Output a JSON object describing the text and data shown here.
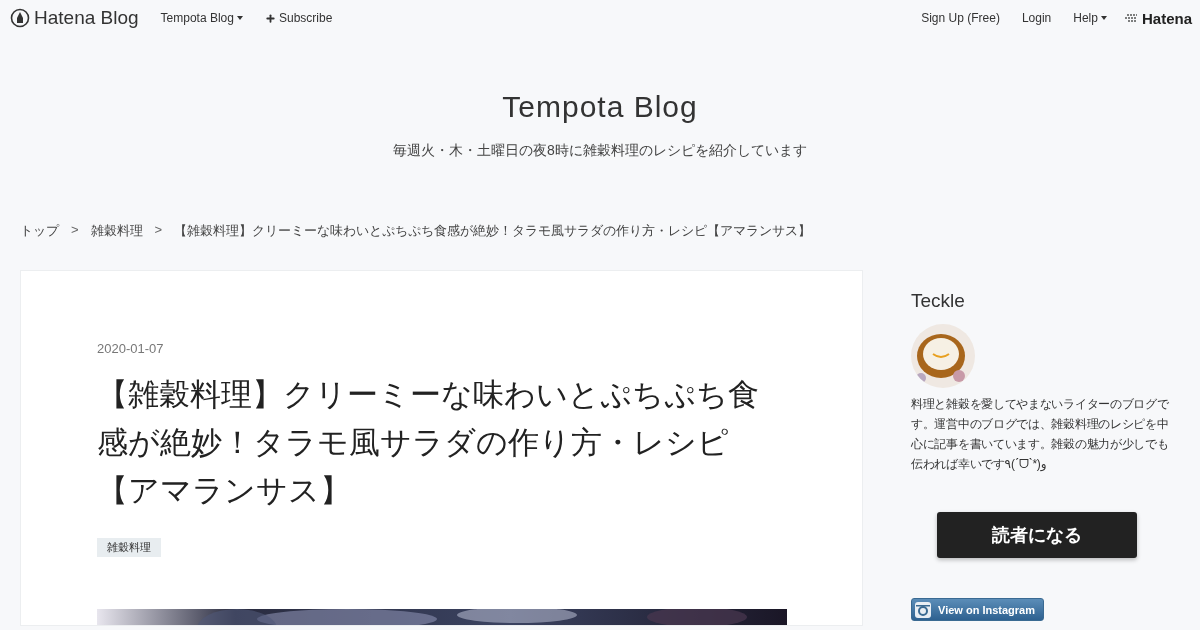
{
  "topbar": {
    "logo": "Hatena Blog",
    "left_links": [
      {
        "label": "Tempota Blog",
        "dropdown": true
      },
      {
        "label": "Subscribe",
        "dropdown": false
      }
    ],
    "right_links": [
      {
        "label": "Sign Up (Free)",
        "dropdown": false
      },
      {
        "label": "Login",
        "dropdown": false
      },
      {
        "label": "Help",
        "dropdown": true
      }
    ],
    "brand": "Hatena"
  },
  "blog": {
    "title": "Tempota Blog",
    "description": "毎週火・木・土曜日の夜8時に雑穀料理のレシピを紹介しています"
  },
  "breadcrumb": [
    "トップ",
    "雑穀料理",
    "【雑穀料理】クリーミーな味わいとぷちぷち食感が絶妙！タラモ風サラダの作り方・レシピ【アマランサス】"
  ],
  "breadcrumb_separator": ">",
  "article": {
    "date": "2020-01-07",
    "title": "【雑穀料理】クリーミーな味わいとぷちぷち食感が絶妙！タラモ風サラダの作り方・レシピ【アマランサス】",
    "categories": [
      "雑穀料理"
    ],
    "image": {
      "kind": "picture"
    }
  },
  "sidebar": {
    "author": "Teckle",
    "bio": "料理と雑穀を愛してやまないライターのブログです。運営中のブログでは、雑穀料理のレシピを中心に記事を書いています。雑穀の魅力が少しでも伝われば幸いです٩(ˊᗜˋ*)و",
    "subscribe_button": "読者になる",
    "instagram_button": "View on Instagram"
  }
}
